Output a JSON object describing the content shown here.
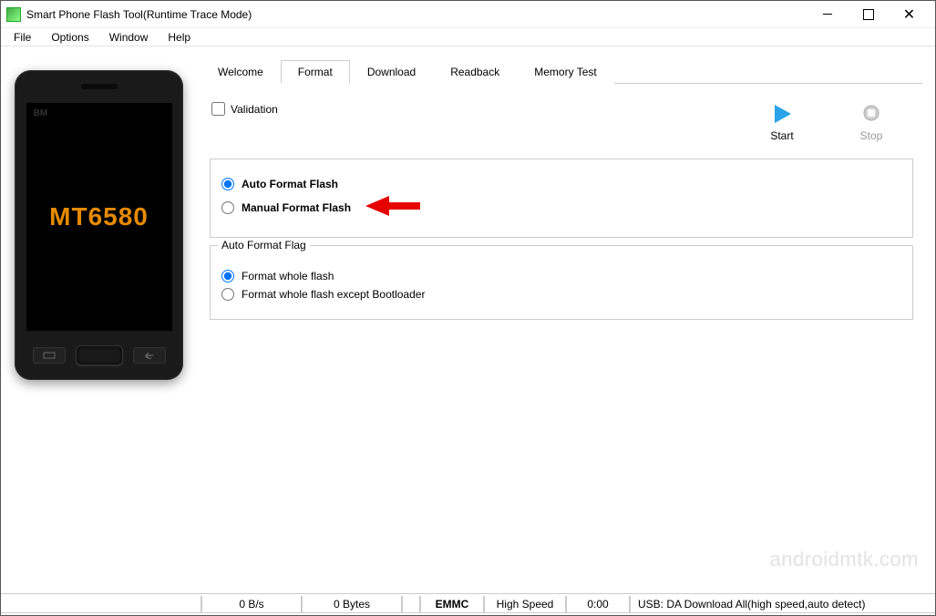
{
  "window": {
    "title": "Smart Phone Flash Tool(Runtime Trace Mode)"
  },
  "menubar": {
    "items": [
      "File",
      "Options",
      "Window",
      "Help"
    ]
  },
  "phone": {
    "screen_text": "MT6580",
    "corner_label": "BM"
  },
  "tabs": {
    "items": [
      "Welcome",
      "Format",
      "Download",
      "Readback",
      "Memory Test"
    ],
    "active_index": 1
  },
  "format_tab": {
    "validation_label": "Validation",
    "start_label": "Start",
    "stop_label": "Stop",
    "mode_group": {
      "options": [
        {
          "label": "Auto Format Flash",
          "checked": true
        },
        {
          "label": "Manual Format Flash",
          "checked": false
        }
      ]
    },
    "auto_flag_group": {
      "legend": "Auto Format Flag",
      "options": [
        {
          "label": "Format whole flash",
          "checked": true
        },
        {
          "label": "Format whole flash except Bootloader",
          "checked": false
        }
      ]
    }
  },
  "statusbar": {
    "speed": "0 B/s",
    "bytes": "0 Bytes",
    "storage": "EMMC",
    "bus": "High Speed",
    "time": "0:00",
    "usb_mode": "USB: DA Download All(high speed,auto detect)"
  },
  "watermark": "androidmtk.com"
}
